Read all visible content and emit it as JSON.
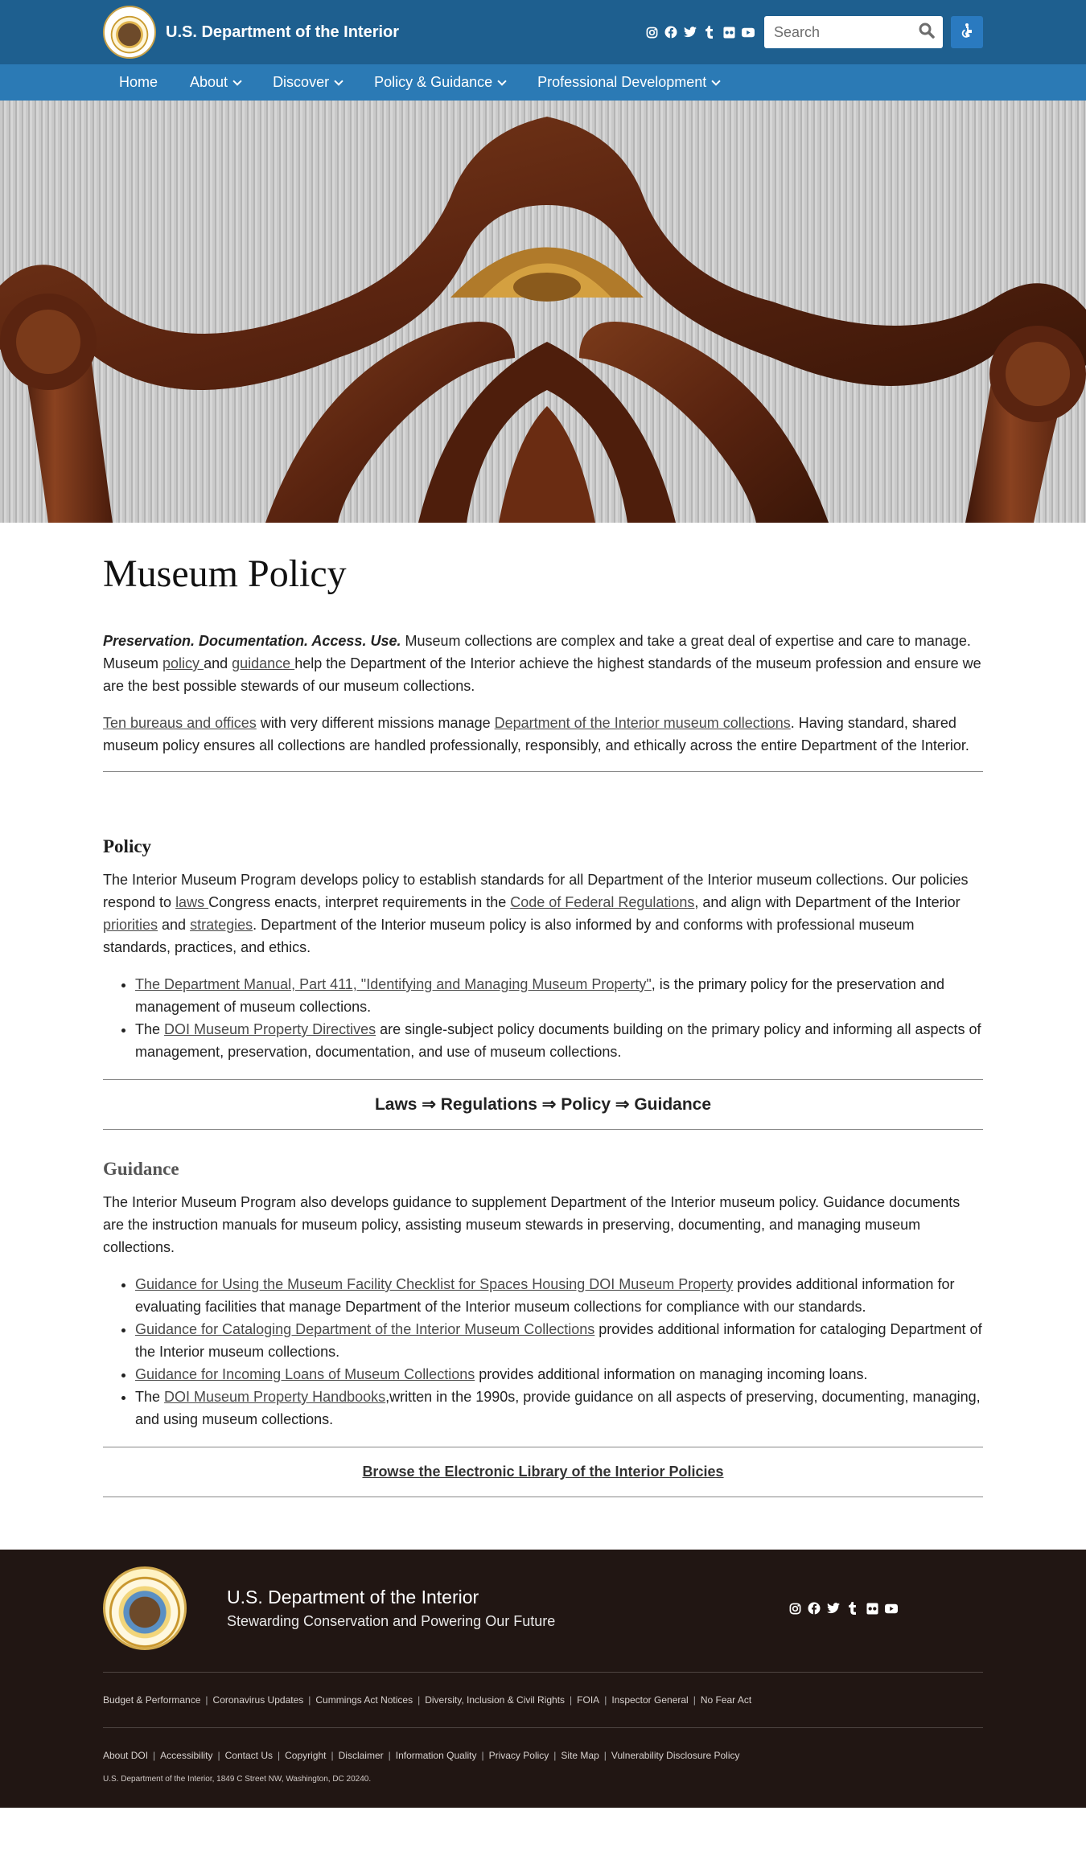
{
  "header": {
    "agency_name": "U.S. Department of the Interior",
    "social_icons": [
      "instagram-icon",
      "facebook-icon",
      "twitter-icon",
      "tumblr-icon",
      "flickr-icon",
      "youtube-icon"
    ],
    "search_placeholder": "Search",
    "accessibility_icon": "accessibility-icon"
  },
  "nav": {
    "items": [
      {
        "label": "Home",
        "dropdown": false
      },
      {
        "label": "About",
        "dropdown": true
      },
      {
        "label": "Discover",
        "dropdown": true
      },
      {
        "label": "Policy & Guidance",
        "dropdown": true
      },
      {
        "label": "Professional Development",
        "dropdown": true
      }
    ]
  },
  "page": {
    "title": "Museum Policy",
    "intro": {
      "lead_bold": "Preservation. Documentation. Access. Use.",
      "p1_a": " Museum collections are complex and take a great deal of expertise and care to manage. Museum ",
      "p1_link1": "policy ",
      "p1_b": "and ",
      "p1_link2": "guidance ",
      "p1_c": "help the Department of the Interior achieve the highest standards of the museum profession and ensure we are the best possible stewards of our museum collections.",
      "p2_link1": "Ten bureaus and offices",
      "p2_a": " with very different missions manage ",
      "p2_link2": "Department of the Interior museum collections",
      "p2_b": ". Having standard, shared museum policy ensures all collections are handled professionally, responsibly, and ethically across the entire Department of the Interior."
    },
    "policy": {
      "heading": "Policy",
      "p_a": "The Interior Museum Program develops policy to establish standards for all Department of the Interior museum collections. Our policies respond to ",
      "p_link_laws": "laws ",
      "p_b": "Congress enacts, interpret requirements in the ",
      "p_link_cfr": "Code of Federal Regulations",
      "p_c": ", and align with Department of the Interior ",
      "p_link_priorities": "priorities",
      "p_d": " and  ",
      "p_link_strategies": "strategies",
      "p_e": ". Department of the Interior museum policy is also informed by and conforms with professional museum standards, practices, and ethics.",
      "bullet1_link": "The Department Manual, Part 411, \"Identifying and Managing Museum Property\"",
      "bullet1_text": ", is the primary policy for the preservation and management of museum collections.",
      "bullet2_pre": "The ",
      "bullet2_link": "DOI Museum Property Directives",
      "bullet2_text": " are single-subject policy documents building on the primary policy and informing all aspects of management, preservation, documentation, and use of museum collections."
    },
    "hierarchy_band": "Laws ⇒ Regulations ⇒ Policy  ⇒ Guidance",
    "guidance": {
      "heading": "Guidance",
      "p": "The Interior Museum Program also develops guidance to supplement Department of the Interior museum policy. Guidance documents are the instruction manuals for museum policy, assisting museum stewards in preserving, documenting, and managing museum collections.",
      "b1_link": "Guidance for Using the Museum Facility Checklist for Spaces Housing DOI Museum Property",
      "b1_text": "  provides additional information for evaluating facilities that manage Department of the Interior museum collections for compliance with our standards.",
      "b2_link": "Guidance for Cataloging Department of the Interior Museum Collections",
      "b2_text": " provides additional information for cataloging Department of the Interior museum collections.",
      "b3_link": "Guidance for Incoming Loans of Museum Collections",
      "b3_text": " provides additional information on managing incoming loans.",
      "b4_pre": "The ",
      "b4_link": "DOI Museum Property Handbooks",
      "b4_text": ",written in the 1990s, provide guidance on all aspects of preserving, documenting, managing, and using museum collections."
    },
    "browse_link": "Browse the Electronic Library of the Interior Policies"
  },
  "footer": {
    "title": "U.S. Department of the Interior",
    "tagline": "Stewarding Conservation and Powering Our Future",
    "links_row1": [
      "Budget & Performance",
      "Coronavirus Updates",
      "Cummings Act Notices",
      "Diversity, Inclusion & Civil Rights",
      "FOIA",
      "Inspector General",
      "No Fear Act"
    ],
    "links_row2": [
      "About DOI",
      "Accessibility",
      "Contact Us",
      "Copyright",
      "Disclaimer",
      "Information Quality",
      "Privacy Policy",
      "Site Map",
      "Vulnerability Disclosure Policy"
    ],
    "address": "U.S. Department of the Interior, 1849 C Street NW, Washington, DC 20240.",
    "seal_text": "U.S. DEPARTMENT OF THE INTERIOR MARCH 3, 1849"
  },
  "colors": {
    "topbar": "#1e5f8f",
    "navbar": "#2b7ab5",
    "footer": "#211613"
  }
}
